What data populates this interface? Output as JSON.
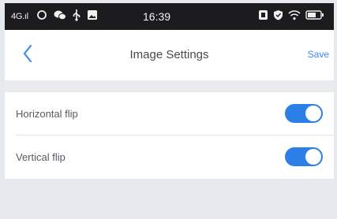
{
  "status_bar": {
    "signal": "4G.ıl",
    "time": "16:39",
    "icons_left": [
      "circle-icon",
      "wechat-icon",
      "usb-icon",
      "image-icon"
    ],
    "icons_right": [
      "nfc-icon",
      "shield-icon",
      "wifi-icon",
      "battery-icon"
    ]
  },
  "nav": {
    "title": "Image Settings",
    "save_label": "Save",
    "accent_color": "#3d8af2"
  },
  "settings": [
    {
      "label": "Horizontal flip",
      "enabled": true
    },
    {
      "label": "Vertical flip",
      "enabled": true
    }
  ],
  "colors": {
    "toggle_on": "#2d7fe8",
    "background": "#e6e9ee"
  }
}
